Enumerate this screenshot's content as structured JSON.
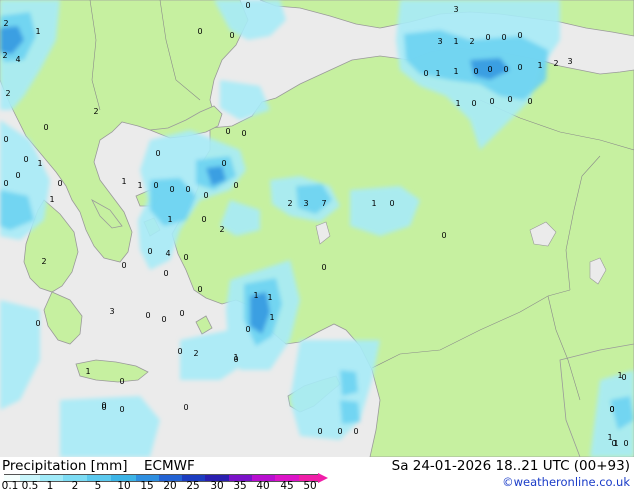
{
  "title": "Precipitation [mm]",
  "model": "ECMWF",
  "valid_time": "Sa 24-01-2026 18..21 UTC (00+93)",
  "credit": "©weatheronline.co.uk",
  "colorbar": {
    "labels": [
      "0.1",
      "0.5",
      "1",
      "2",
      "5",
      "10",
      "15",
      "20",
      "25",
      "30",
      "35",
      "40",
      "45",
      "50"
    ],
    "colors": [
      "#f5fffe",
      "#c8f5fb",
      "#a0eaf8",
      "#7ddcf4",
      "#5cc9ee",
      "#3db4e6",
      "#2f8fe0",
      "#2463d3",
      "#1c3dc0",
      "#2a1fb0",
      "#7a12c8",
      "#b80fd0",
      "#dc14c8",
      "#f01ea8"
    ]
  },
  "colors": {
    "land": "#c6f0a0",
    "sea": "#ebebeb",
    "precip_light": "#a8ecf8",
    "precip_mid": "#6fd3f1",
    "precip_heavy": "#3a9fe2"
  },
  "values": [
    "2",
    "3",
    "1",
    "2",
    "4",
    "0",
    "0",
    "0",
    "2",
    "3",
    "1",
    "2",
    "0",
    "0",
    "0",
    "1",
    "1",
    "0",
    "0",
    "0",
    "0",
    "0",
    "1",
    "2",
    "3",
    "2",
    "0",
    "0",
    "0",
    "0",
    "0",
    "1",
    "0",
    "0",
    "1",
    "1",
    "0",
    "0",
    "0",
    "0",
    "0",
    "1",
    "0",
    "2",
    "3",
    "7",
    "1",
    "0",
    "1",
    "0",
    "2",
    "0",
    "4",
    "0",
    "2",
    "0",
    "0",
    "0",
    "1",
    "1",
    "3",
    "0",
    "0",
    "0",
    "0",
    "1",
    "0",
    "0",
    "2",
    "1",
    "1",
    "0",
    "0",
    "0",
    "0",
    "0",
    "0",
    "0",
    "0",
    "0",
    "0",
    "0",
    "0",
    "0",
    "0",
    "0",
    "1",
    "0",
    "0",
    "0",
    "0",
    "0",
    "1",
    "1",
    "0",
    "1",
    "0"
  ]
}
